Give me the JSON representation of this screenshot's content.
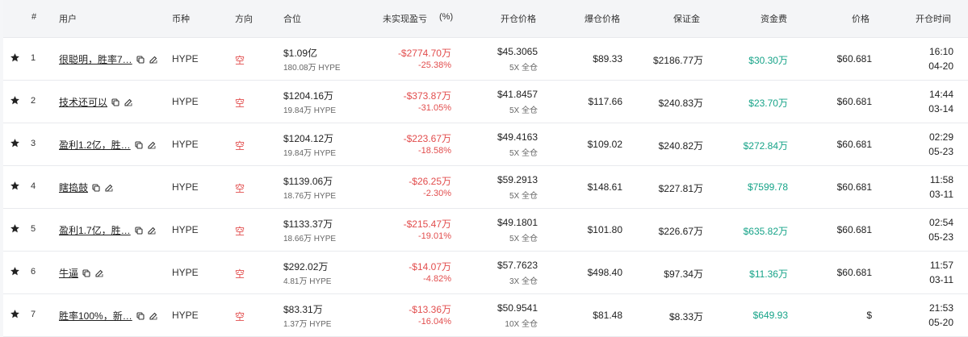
{
  "headers": {
    "index": "#",
    "user": "用户",
    "coin": "币种",
    "direction": "方向",
    "position": "合位",
    "pnl": "未实现盈亏",
    "pnl_pct": "(%)",
    "open_price": "开仓价格",
    "liq_price": "爆仓价格",
    "margin": "保证金",
    "funding": "资金费",
    "price": "价格",
    "open_time": "开仓时间"
  },
  "rows": [
    {
      "index": "1",
      "user": "很聪明，胜率7…",
      "coin": "HYPE",
      "direction": "空",
      "position_value": "$1.09亿",
      "position_size": "180.08万 HYPE",
      "pnl": "-$2774.70万",
      "pnl_pct": "-25.38%",
      "open_price": "$45.3065",
      "leverage": "5X 全仓",
      "liq_price": "$89.33",
      "margin": "$2186.77万",
      "funding": "$30.30万",
      "price": "$60.681",
      "time": "16:10",
      "date": "04-20"
    },
    {
      "index": "2",
      "user": "技术还可以",
      "coin": "HYPE",
      "direction": "空",
      "position_value": "$1204.16万",
      "position_size": "19.84万 HYPE",
      "pnl": "-$373.87万",
      "pnl_pct": "-31.05%",
      "open_price": "$41.8457",
      "leverage": "5X 全仓",
      "liq_price": "$117.66",
      "margin": "$240.83万",
      "funding": "$23.70万",
      "price": "$60.681",
      "time": "14:44",
      "date": "03-14"
    },
    {
      "index": "3",
      "user": "盈利1.2亿，胜…",
      "coin": "HYPE",
      "direction": "空",
      "position_value": "$1204.12万",
      "position_size": "19.84万 HYPE",
      "pnl": "-$223.67万",
      "pnl_pct": "-18.58%",
      "open_price": "$49.4163",
      "leverage": "5X 全仓",
      "liq_price": "$109.02",
      "margin": "$240.82万",
      "funding": "$272.84万",
      "price": "$60.681",
      "time": "02:29",
      "date": "05-23"
    },
    {
      "index": "4",
      "user": "瞎捣鼓",
      "coin": "HYPE",
      "direction": "空",
      "position_value": "$1139.06万",
      "position_size": "18.76万 HYPE",
      "pnl": "-$26.25万",
      "pnl_pct": "-2.30%",
      "open_price": "$59.2913",
      "leverage": "5X 全仓",
      "liq_price": "$148.61",
      "margin": "$227.81万",
      "funding": "$7599.78",
      "price": "$60.681",
      "time": "11:58",
      "date": "03-11"
    },
    {
      "index": "5",
      "user": "盈利1.7亿，胜…",
      "coin": "HYPE",
      "direction": "空",
      "position_value": "$1133.37万",
      "position_size": "18.66万 HYPE",
      "pnl": "-$215.47万",
      "pnl_pct": "-19.01%",
      "open_price": "$49.1801",
      "leverage": "5X 全仓",
      "liq_price": "$101.80",
      "margin": "$226.67万",
      "funding": "$635.82万",
      "price": "$60.681",
      "time": "02:54",
      "date": "05-23"
    },
    {
      "index": "6",
      "user": "牛逼",
      "coin": "HYPE",
      "direction": "空",
      "position_value": "$292.02万",
      "position_size": "4.81万 HYPE",
      "pnl": "-$14.07万",
      "pnl_pct": "-4.82%",
      "open_price": "$57.7623",
      "leverage": "3X 全仓",
      "liq_price": "$498.40",
      "margin": "$97.34万",
      "funding": "$11.36万",
      "price": "$60.681",
      "time": "11:57",
      "date": "03-11"
    },
    {
      "index": "7",
      "user": "胜率100%，新…",
      "coin": "HYPE",
      "direction": "空",
      "position_value": "$83.31万",
      "position_size": "1.37万 HYPE",
      "pnl": "-$13.36万",
      "pnl_pct": "-16.04%",
      "open_price": "$50.9541",
      "leverage": "10X 全仓",
      "liq_price": "$81.48",
      "margin": "$8.33万",
      "funding": "$649.93",
      "price": "$",
      "time": "21:53",
      "date": "05-20"
    }
  ],
  "icons": {
    "favorite": "star-icon",
    "copy": "copy-icon",
    "edit": "edit-icon"
  },
  "colors": {
    "loss": "#e24d4d",
    "funding": "#16a388",
    "short": "#e24d4d"
  }
}
